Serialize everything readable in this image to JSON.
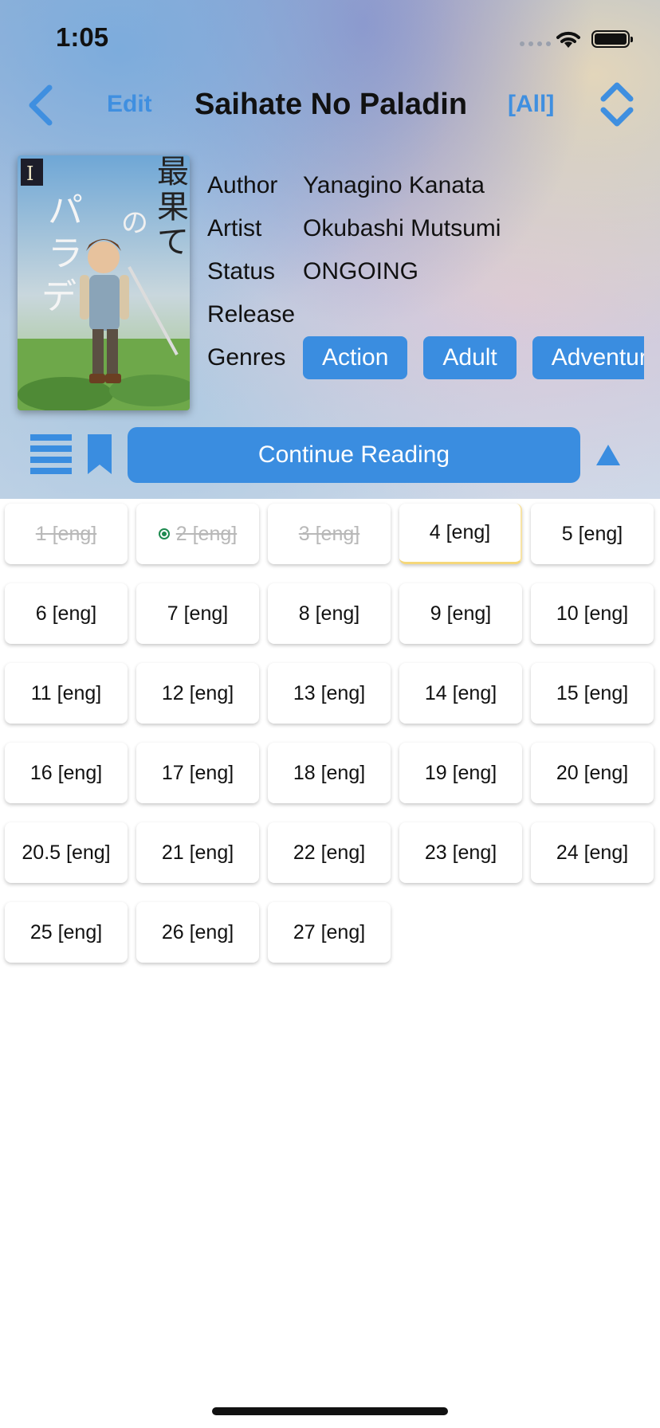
{
  "status_bar": {
    "time": "1:05"
  },
  "nav": {
    "edit_label": "Edit",
    "title": "Saihate No Paladin",
    "filter_label": "[All]"
  },
  "cover": {
    "alt": "Saihate No Paladin cover",
    "title_text": "最果てのパラディン",
    "volume": "I"
  },
  "info": {
    "author_label": "Author",
    "author": "Yanagino Kanata",
    "artist_label": "Artist",
    "artist": "Okubashi Mutsumi",
    "status_label": "Status",
    "status": "ONGOING",
    "release_label": "Release",
    "release": "",
    "genres_label": "Genres",
    "genres": [
      "Action",
      "Adult",
      "Adventure"
    ]
  },
  "actions": {
    "continue_label": "Continue Reading"
  },
  "colors": {
    "accent": "#3a8de0",
    "read_text": "#b8b8b8",
    "current_marker": "#1d8a4f",
    "highlight": "#f5d77a"
  },
  "chapters": [
    {
      "label": "1 [eng]",
      "state": "read"
    },
    {
      "label": "2 [eng]",
      "state": "read-current"
    },
    {
      "label": "3 [eng]",
      "state": "read"
    },
    {
      "label": "4 [eng]",
      "state": "highlight"
    },
    {
      "label": "5 [eng]",
      "state": "unread"
    },
    {
      "label": "6 [eng]",
      "state": "unread"
    },
    {
      "label": "7 [eng]",
      "state": "unread"
    },
    {
      "label": "8 [eng]",
      "state": "unread"
    },
    {
      "label": "9 [eng]",
      "state": "unread"
    },
    {
      "label": "10 [eng]",
      "state": "unread"
    },
    {
      "label": "11 [eng]",
      "state": "unread"
    },
    {
      "label": "12 [eng]",
      "state": "unread"
    },
    {
      "label": "13 [eng]",
      "state": "unread"
    },
    {
      "label": "14 [eng]",
      "state": "unread"
    },
    {
      "label": "15 [eng]",
      "state": "unread"
    },
    {
      "label": "16 [eng]",
      "state": "unread"
    },
    {
      "label": "17 [eng]",
      "state": "unread"
    },
    {
      "label": "18 [eng]",
      "state": "unread"
    },
    {
      "label": "19 [eng]",
      "state": "unread"
    },
    {
      "label": "20 [eng]",
      "state": "unread"
    },
    {
      "label": "20.5 [eng]",
      "state": "unread"
    },
    {
      "label": "21 [eng]",
      "state": "unread"
    },
    {
      "label": "22 [eng]",
      "state": "unread"
    },
    {
      "label": "23 [eng]",
      "state": "unread"
    },
    {
      "label": "24 [eng]",
      "state": "unread"
    },
    {
      "label": "25 [eng]",
      "state": "unread"
    },
    {
      "label": "26 [eng]",
      "state": "unread"
    },
    {
      "label": "27 [eng]",
      "state": "unread"
    }
  ]
}
